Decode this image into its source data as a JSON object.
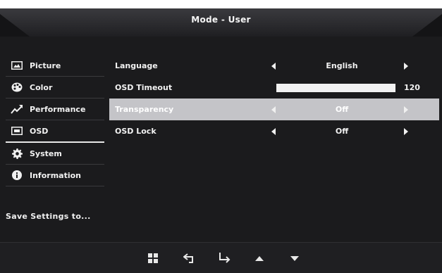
{
  "header": {
    "title": "Mode - User"
  },
  "sidebar": {
    "items": [
      {
        "label": "Picture",
        "icon": "picture-icon"
      },
      {
        "label": "Color",
        "icon": "palette-icon"
      },
      {
        "label": "Performance",
        "icon": "trend-arrow-icon"
      },
      {
        "label": "OSD",
        "icon": "osd-screen-icon",
        "active": true
      },
      {
        "label": "System",
        "icon": "gear-icon"
      },
      {
        "label": "Information",
        "icon": "info-icon"
      }
    ],
    "save_settings": "Save Settings to..."
  },
  "settings": [
    {
      "label": "Language",
      "value": "English"
    },
    {
      "label": "OSD Timeout",
      "value": "120",
      "level_fraction": 1.0
    },
    {
      "label": "Transparency",
      "value": "Off",
      "selected": true
    },
    {
      "label": "OSD Lock",
      "value": "Off"
    }
  ],
  "footer": {
    "buttons": [
      "menu-grid-icon",
      "back-icon",
      "enter-icon",
      "up-icon",
      "down-icon"
    ]
  },
  "colors": {
    "background": "#1b1b1d",
    "selected_row": "#c4c4c8",
    "text": "#f2f2f2"
  }
}
